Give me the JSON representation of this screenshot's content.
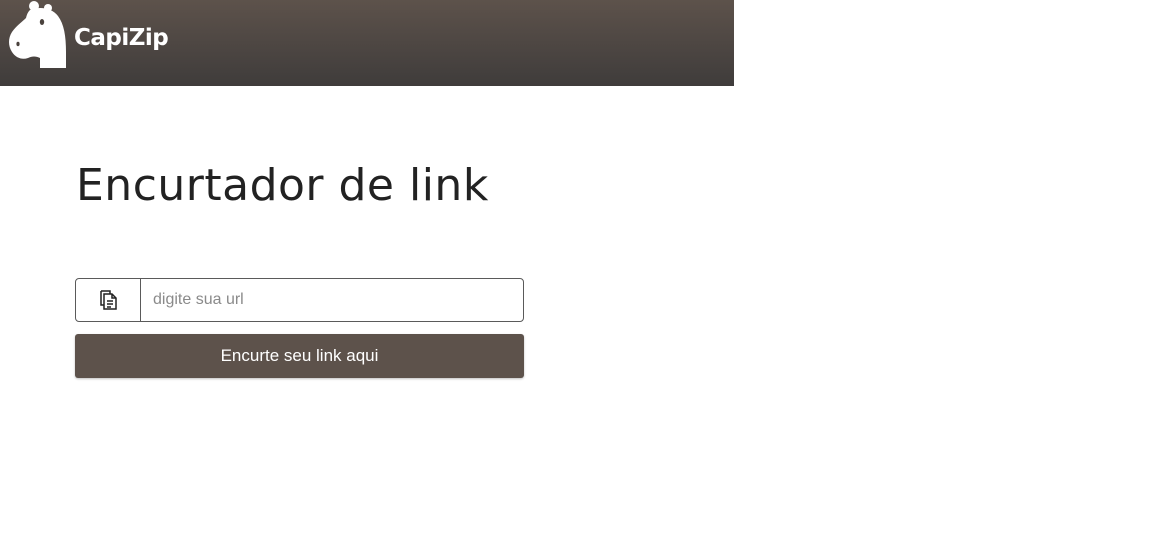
{
  "header": {
    "brand_name": "CapiZip",
    "logo_icon": "capybara-icon",
    "background_top": "#5d524b",
    "background_bottom": "#3f3c3b"
  },
  "main": {
    "title": "Encurtador de link",
    "url_input": {
      "value": "",
      "placeholder": "digite sua url",
      "icon": "paste-document-icon"
    },
    "submit_label": "Encurte seu link aqui",
    "button_color": "#5d524b"
  }
}
